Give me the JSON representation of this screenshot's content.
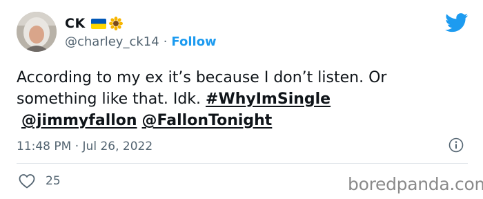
{
  "tweet": {
    "display_name": "CK",
    "handle": "@charley_ck14",
    "separator": "·",
    "follow_label": "Follow",
    "text_part1": "According to my ex it’s because I don’t listen. Or something like that. Idk.  ",
    "hashtag": "#WhyImSingle",
    "mention1": "@jimmyfallon",
    "mention2": "@FallonTonight",
    "timestamp": "11:48 PM · Jul 26, 2022",
    "like_count": "25"
  },
  "watermark": "boredpanda.com",
  "colors": {
    "accent": "#1d9bf0",
    "muted_text": "#536471",
    "primary_text": "#0f1419",
    "flag_blue": "#0057b7",
    "flag_yellow": "#ffd700"
  },
  "icons": {
    "brand": "twitter-bird-icon",
    "info": "info-icon",
    "like": "heart-icon",
    "flag": "ukraine-flag-icon",
    "sunflower": "sunflower-icon"
  }
}
